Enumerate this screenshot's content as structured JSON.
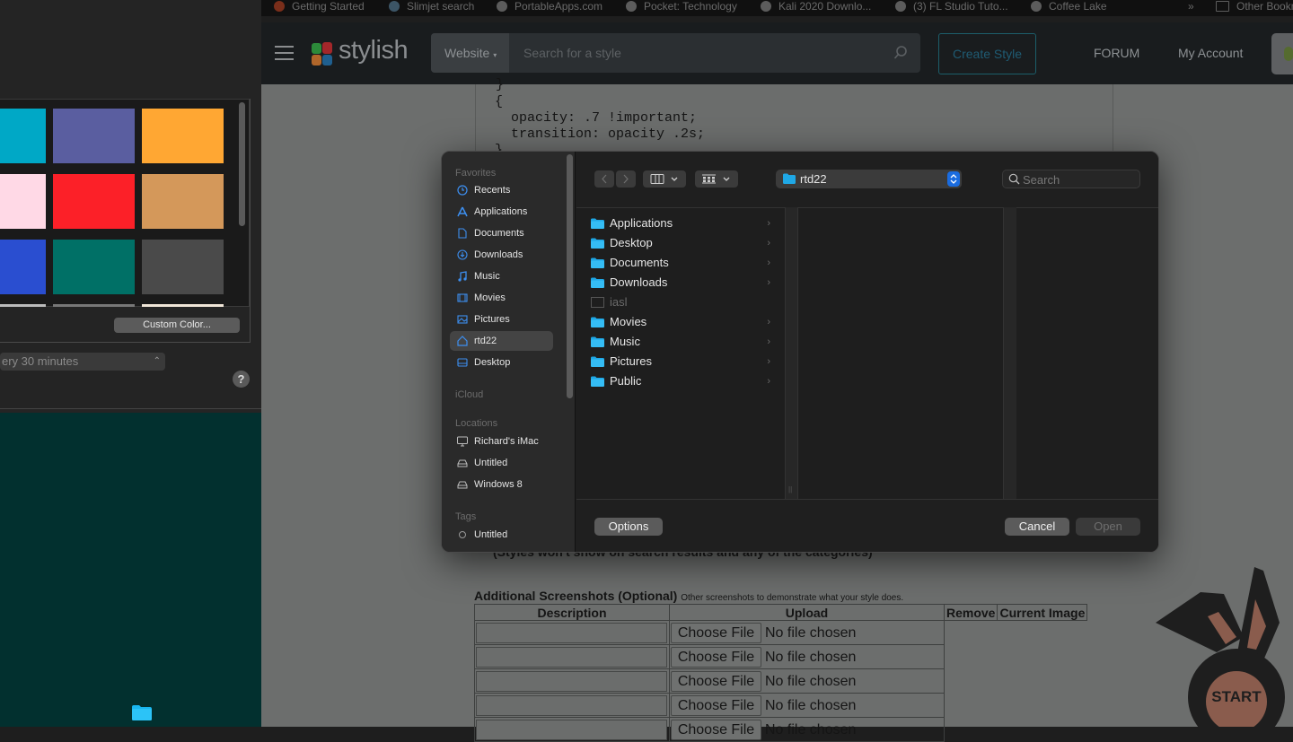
{
  "bookmarks": [
    {
      "label": "Getting Started",
      "icon": "firefox-icon"
    },
    {
      "label": "Slimjet search",
      "icon": "slimjet-icon"
    },
    {
      "label": "PortableApps.com",
      "icon": "portableapps-icon"
    },
    {
      "label": "Pocket: Technology",
      "icon": "globe-icon"
    },
    {
      "label": "Kali 2020 Downlo...",
      "icon": "globe-icon"
    },
    {
      "label": "(3) FL Studio Tuto...",
      "icon": "globe-icon"
    },
    {
      "label": "Coffee Lake",
      "icon": "globe-icon"
    }
  ],
  "bookmarks_overflow": "»",
  "other_bookmarks": "Other Bookmarks",
  "header": {
    "logo_text": "stylish",
    "search_scope": "Website",
    "search_placeholder": "Search for a style",
    "create_style": "Create Style",
    "forum": "FORUM",
    "my_account": "My Account"
  },
  "code_snippet": {
    "lines": [
      "{",
      "  opacity: .7 !important;",
      "  transition: opacity .2s;",
      "}"
    ]
  },
  "page": {
    "note": "(Styles won't show on search results and any of the categories)",
    "additional_title": "Additional Screenshots (Optional)",
    "additional_subtitle": "Other screenshots to demonstrate what your style does.",
    "table_headers": [
      "Description",
      "Upload",
      "Remove",
      "Current Image"
    ],
    "rows": [
      {
        "choose": "Choose File",
        "status": "No file chosen"
      },
      {
        "choose": "Choose File",
        "status": "No file chosen"
      },
      {
        "choose": "Choose File",
        "status": "No file chosen"
      },
      {
        "choose": "Choose File",
        "status": "No file chosen"
      },
      {
        "choose": "Choose File",
        "status": "No file chosen"
      }
    ],
    "start_badge": "START"
  },
  "color_picker": {
    "swatches": [
      "#00a8c6",
      "#5a5ea0",
      "#ffa733",
      "#ffd9e6",
      "#fc2028",
      "#d4985a",
      "#2a4ed0",
      "#007066",
      "#4a4a4a"
    ],
    "custom_color": "Custom Color...",
    "interval": "ery 30 minutes",
    "help": "?"
  },
  "dialog": {
    "sidebar": {
      "favorites_header": "Favorites",
      "favorites": [
        {
          "label": "Recents",
          "icon": "clock-icon"
        },
        {
          "label": "Applications",
          "icon": "applications-icon"
        },
        {
          "label": "Documents",
          "icon": "document-icon"
        },
        {
          "label": "Downloads",
          "icon": "download-icon"
        },
        {
          "label": "Music",
          "icon": "music-icon"
        },
        {
          "label": "Movies",
          "icon": "film-icon"
        },
        {
          "label": "Pictures",
          "icon": "picture-icon"
        },
        {
          "label": "rtd22",
          "icon": "home-icon",
          "selected": true
        },
        {
          "label": "Desktop",
          "icon": "desktop-icon"
        }
      ],
      "icloud_header": "iCloud",
      "locations_header": "Locations",
      "locations": [
        {
          "label": "Richard's iMac",
          "icon": "imac-icon"
        },
        {
          "label": "Untitled",
          "icon": "drive-icon"
        },
        {
          "label": "Windows 8",
          "icon": "drive-icon"
        }
      ],
      "tags_header": "Tags",
      "tags": [
        {
          "label": "Untitled",
          "icon": "tag-circle-icon"
        }
      ]
    },
    "toolbar": {
      "current_folder": "rtd22",
      "search_placeholder": "Search"
    },
    "files": [
      {
        "name": "Applications",
        "type": "folder",
        "enabled": true
      },
      {
        "name": "Desktop",
        "type": "folder",
        "enabled": true
      },
      {
        "name": "Documents",
        "type": "folder",
        "enabled": true
      },
      {
        "name": "Downloads",
        "type": "folder",
        "enabled": true
      },
      {
        "name": "iasl",
        "type": "file",
        "enabled": false
      },
      {
        "name": "Movies",
        "type": "folder",
        "enabled": true
      },
      {
        "name": "Music",
        "type": "folder",
        "enabled": true
      },
      {
        "name": "Pictures",
        "type": "folder",
        "enabled": true
      },
      {
        "name": "Public",
        "type": "folder",
        "enabled": true
      }
    ],
    "footer": {
      "options": "Options",
      "cancel": "Cancel",
      "open": "Open"
    }
  },
  "colors": {
    "accent_blue": "#1a6ce0",
    "folder_blue": "#1fa8e6",
    "desktop_teal": "#02302f"
  }
}
